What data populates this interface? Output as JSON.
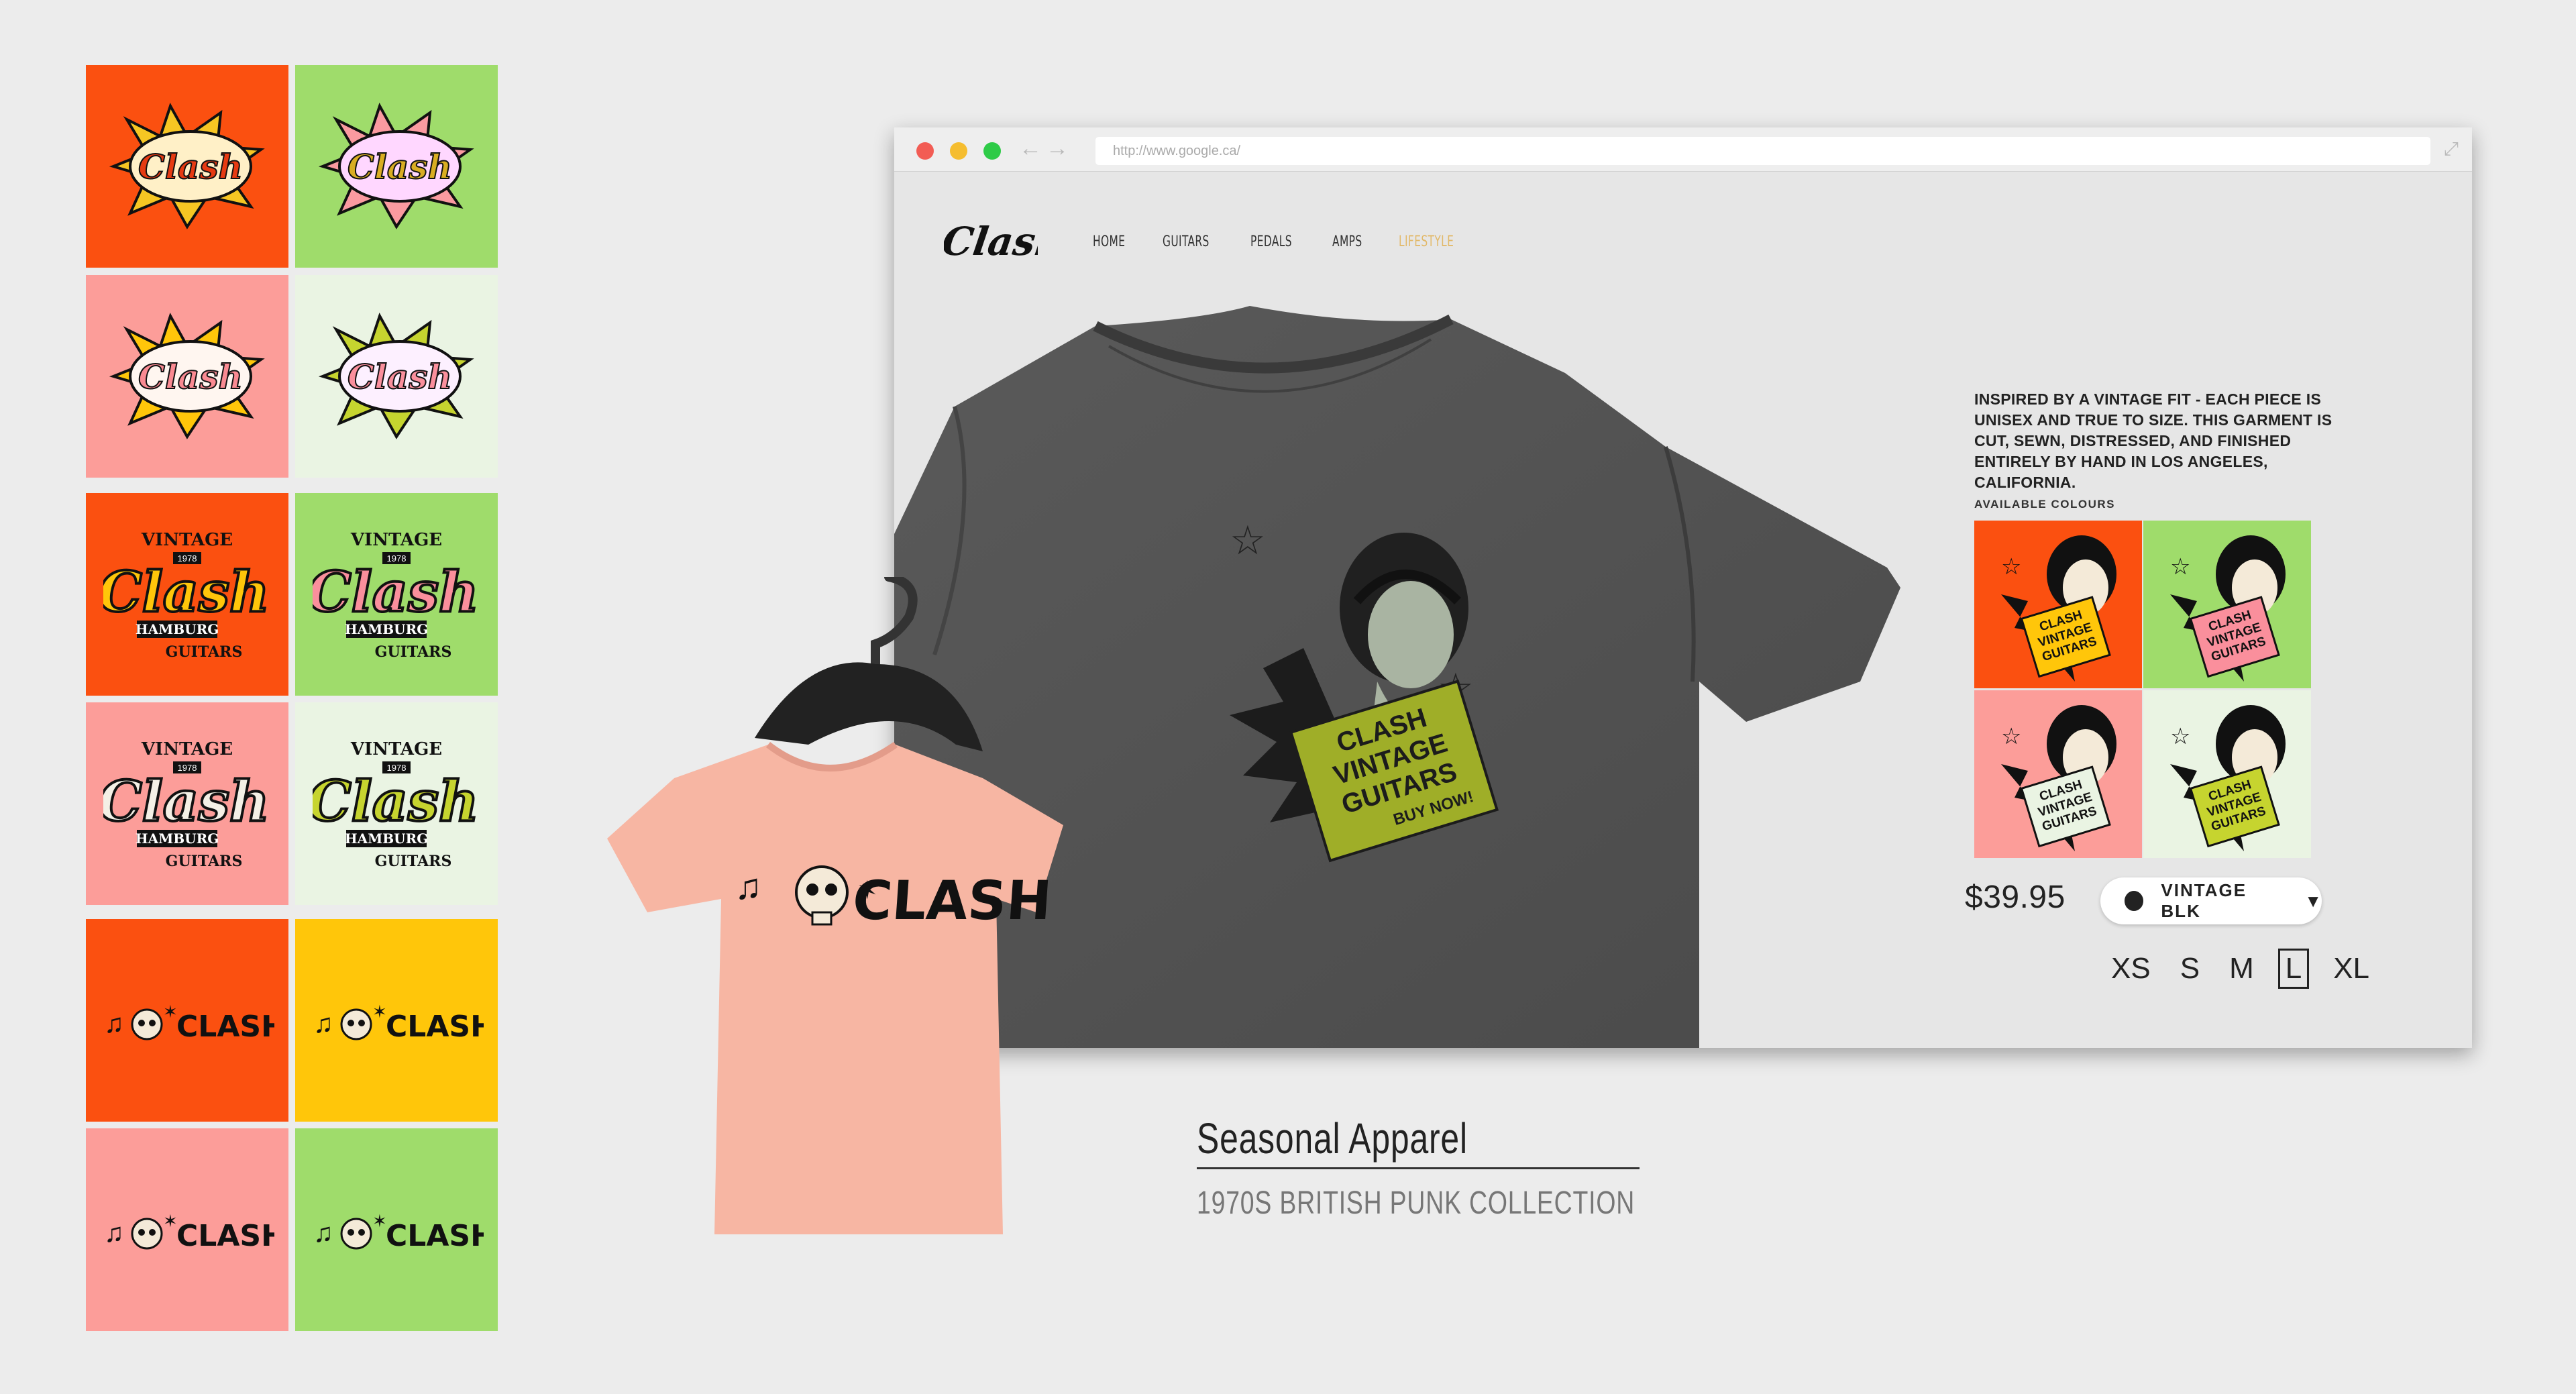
{
  "browser": {
    "url": "http://www.google.ca/",
    "traffic_lights": [
      "#f25c54",
      "#f5bd2f",
      "#2ecb47"
    ],
    "back_icon": "arrow-left-icon",
    "forward_icon": "arrow-right-icon",
    "expand_icon": "expand-icon"
  },
  "site": {
    "brand": "Clash",
    "nav": [
      "HOME",
      "GUITARS",
      "PEDALS",
      "AMPS",
      "LIFESTYLE"
    ],
    "active_nav": "LIFESTYLE",
    "product": {
      "description": "INSPIRED BY A VINTAGE FIT - EACH PIECE IS UNISEX AND TRUE TO SIZE. THIS GARMENT IS CUT, SEWN, DISTRESSED, AND FINISHED ENTIRELY BY HAND IN LOS ANGELES, CALIFORNIA.",
      "available_colours_label": "AVAILABLE COLOURS",
      "swatch_colors": [
        "#fb5010",
        "#9fdc6b",
        "#fc9d99",
        "#eaf4e3"
      ],
      "price": "$39.95",
      "selected_colour": "VINTAGE BLK",
      "sizes": [
        "XS",
        "S",
        "M",
        "L",
        "XL"
      ],
      "selected_size": "L",
      "graphic_lines": [
        "CLASH",
        "VINTAGE",
        "GUITARS",
        "BUY NOW!"
      ]
    }
  },
  "logo_grid": {
    "colors": [
      "#fb5010",
      "#9fdc6b",
      "#fc9d99",
      "#eaf4e3",
      "#fb5010",
      "#9fdc6b",
      "#fc9d99",
      "#eaf4e3",
      "#fb5010",
      "#ffc60a",
      "#fc9d99",
      "#9fdc6b"
    ],
    "burst_text": "Clash",
    "badge_top": "VINTAGE",
    "badge_mid": "HAMBURG",
    "badge_bottom": "GUITARS",
    "badge_year": "1978",
    "skull_text": "CLASH"
  },
  "kid_shirt": {
    "text": "CLASH",
    "color": "#f7b6a3"
  },
  "caption": {
    "title": "Seasonal Apparel",
    "subtitle": "1970S BRITISH PUNK COLLECTION"
  }
}
